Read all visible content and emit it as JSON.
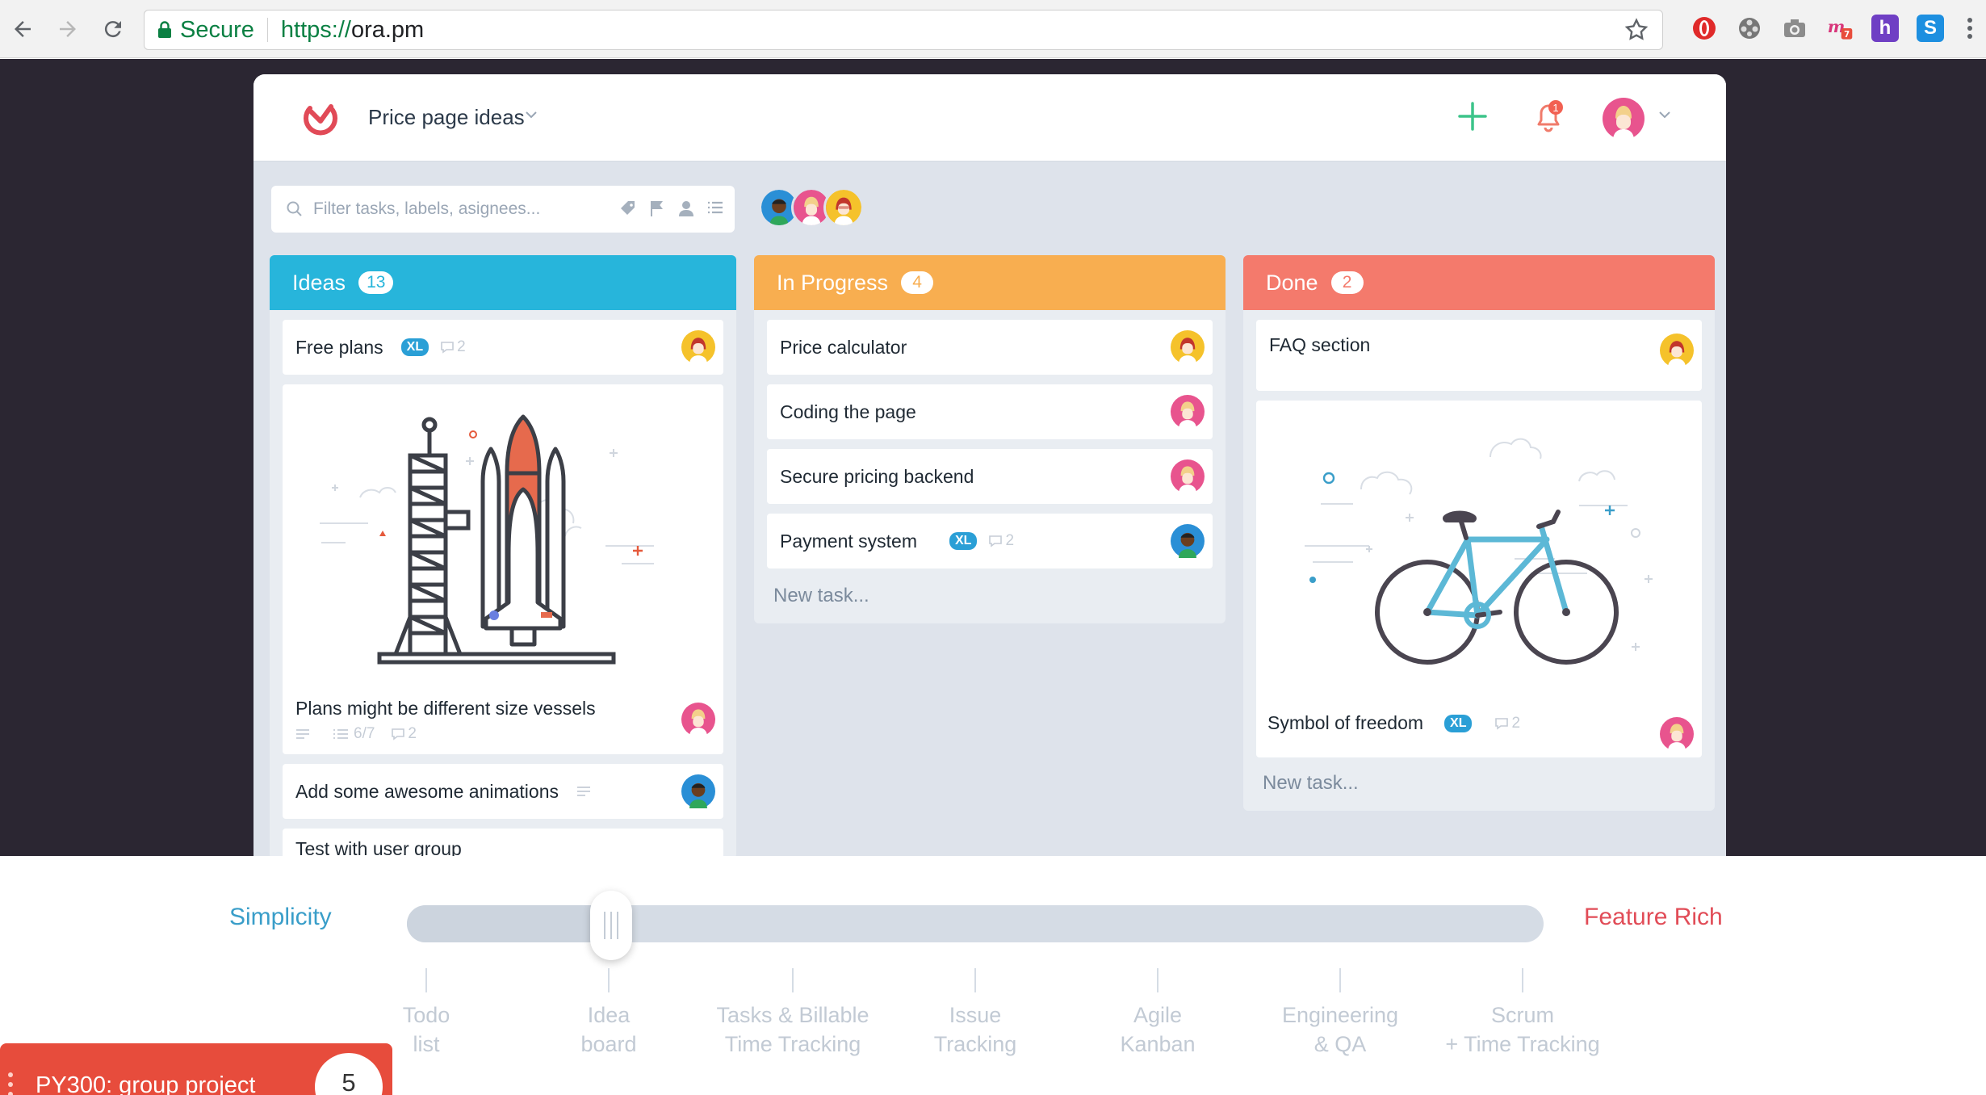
{
  "browser": {
    "secure_label": "Secure",
    "url_scheme": "https://",
    "url_host": "ora.pm"
  },
  "app": {
    "project_title": "Price page ideas",
    "filter_placeholder": "Filter tasks, labels, asignees...",
    "notification_count": "1"
  },
  "columns": {
    "ideas": {
      "title": "Ideas",
      "count": "13",
      "color": "#27b5db",
      "cards": {
        "free_plans": {
          "title": "Free plans",
          "size": "XL",
          "comments": "2"
        },
        "plans_vessels": {
          "title": "Plans might be different size vessels",
          "checklist": "6/7",
          "comments": "2"
        },
        "animations": {
          "title": "Add some awesome animations"
        },
        "user_group": {
          "title": "Test with user group"
        }
      }
    },
    "in_progress": {
      "title": "In Progress",
      "count": "4",
      "color": "#f8ae50",
      "cards": {
        "price_calc": {
          "title": "Price calculator"
        },
        "coding": {
          "title": "Coding the page"
        },
        "backend": {
          "title": "Secure pricing backend"
        },
        "payment": {
          "title": "Payment system",
          "size": "XL",
          "comments": "2"
        }
      },
      "new_task": "New task..."
    },
    "done": {
      "title": "Done",
      "count": "2",
      "color": "#f47a6c",
      "cards": {
        "faq": {
          "title": "FAQ section"
        },
        "freedom": {
          "title": "Symbol of freedom",
          "size": "XL",
          "comments": "2"
        }
      },
      "new_task": "New task..."
    }
  },
  "slider": {
    "left_label": "Simplicity",
    "right_label": "Feature Rich",
    "value_fraction": 0.18,
    "stops": [
      {
        "line1": "Todo",
        "line2": "list"
      },
      {
        "line1": "Idea",
        "line2": "board"
      },
      {
        "line1": "Tasks & Billable",
        "line2": "Time Tracking"
      },
      {
        "line1": "Issue",
        "line2": "Tracking"
      },
      {
        "line1": "Agile",
        "line2": "Kanban"
      },
      {
        "line1": "Engineering",
        "line2": "& QA"
      },
      {
        "line1": "Scrum",
        "line2": "+ Time Tracking"
      }
    ]
  },
  "notification": {
    "text": "PY300: group project",
    "count": "5"
  }
}
